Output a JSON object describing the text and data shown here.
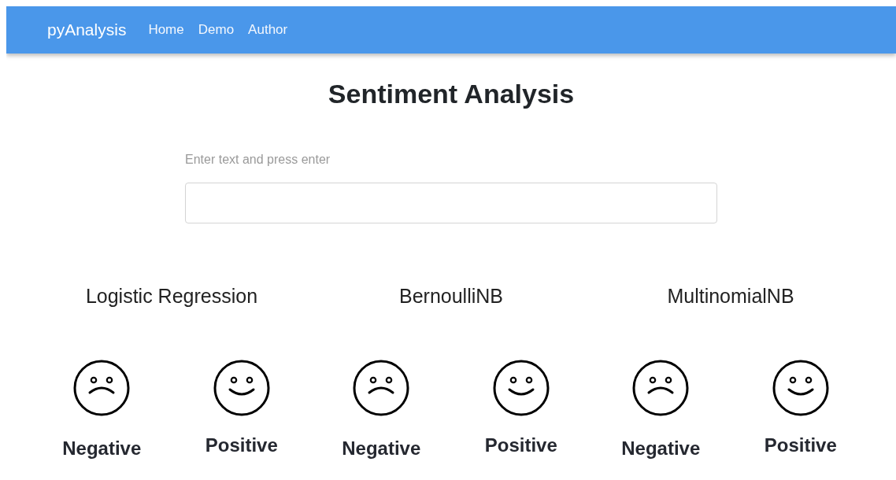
{
  "navbar": {
    "brand": "pyAnalysis",
    "links": [
      "Home",
      "Demo",
      "Author"
    ]
  },
  "title": "Sentiment Analysis",
  "input": {
    "label": "Enter text and press enter"
  },
  "models": [
    {
      "name": "Logistic Regression",
      "results": [
        {
          "kind": "negative",
          "label": "Negative"
        },
        {
          "kind": "positive",
          "label": "Positive"
        }
      ]
    },
    {
      "name": "BernoulliNB",
      "results": [
        {
          "kind": "negative",
          "label": "Negative"
        },
        {
          "kind": "positive",
          "label": "Positive"
        }
      ]
    },
    {
      "name": "MultinomialNB",
      "results": [
        {
          "kind": "negative",
          "label": "Negative"
        },
        {
          "kind": "positive",
          "label": "Positive"
        }
      ]
    }
  ]
}
